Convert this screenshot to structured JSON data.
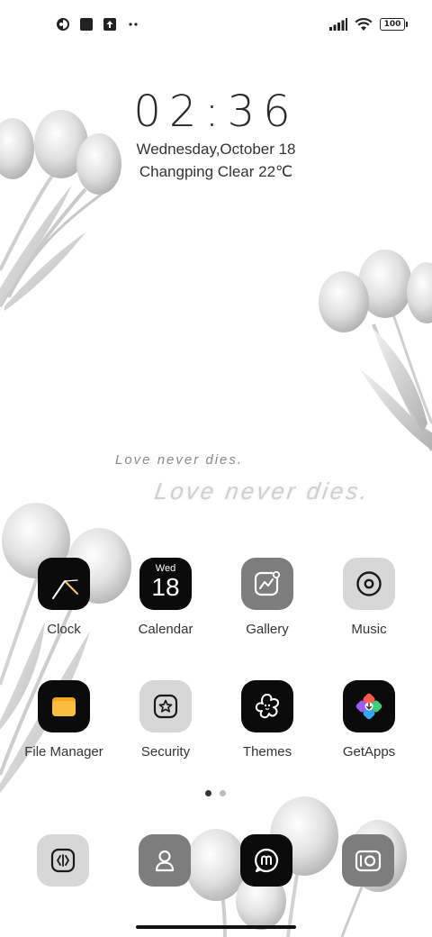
{
  "status_bar": {
    "left_icons": [
      "app-notification-icon",
      "square-notification-icon",
      "upload-notification-icon",
      "more-dots-icon"
    ],
    "right_icons": [
      "signal-icon",
      "wifi-icon",
      "battery-icon"
    ],
    "battery": "100"
  },
  "widget": {
    "time": "02:36",
    "date": "Wednesday,October 18",
    "weather": "Changping Clear 22℃"
  },
  "wallpaper_text": {
    "line1": "Love never dies.",
    "line2": "Love never dies."
  },
  "apps": [
    {
      "label": "Clock",
      "icon": "clock-icon"
    },
    {
      "label": "Calendar",
      "icon": "calendar-icon",
      "day_name": "Wed",
      "day_number": "18"
    },
    {
      "label": "Gallery",
      "icon": "gallery-icon"
    },
    {
      "label": "Music",
      "icon": "music-icon"
    },
    {
      "label": "File Manager",
      "icon": "folder-icon"
    },
    {
      "label": "Security",
      "icon": "security-icon"
    },
    {
      "label": "Themes",
      "icon": "themes-icon"
    },
    {
      "label": "GetApps",
      "icon": "getapps-icon"
    }
  ],
  "page_indicator": {
    "pages": 2,
    "current": 1
  },
  "dock": [
    {
      "icon": "phone-icon"
    },
    {
      "icon": "contacts-icon"
    },
    {
      "icon": "messages-icon"
    },
    {
      "icon": "camera-icon"
    }
  ],
  "colors": {
    "icon_black": "#0b0b0b",
    "icon_grey": "#7d7d7d",
    "icon_light": "#d7d7d7",
    "folder_orange": "#f6a623"
  }
}
